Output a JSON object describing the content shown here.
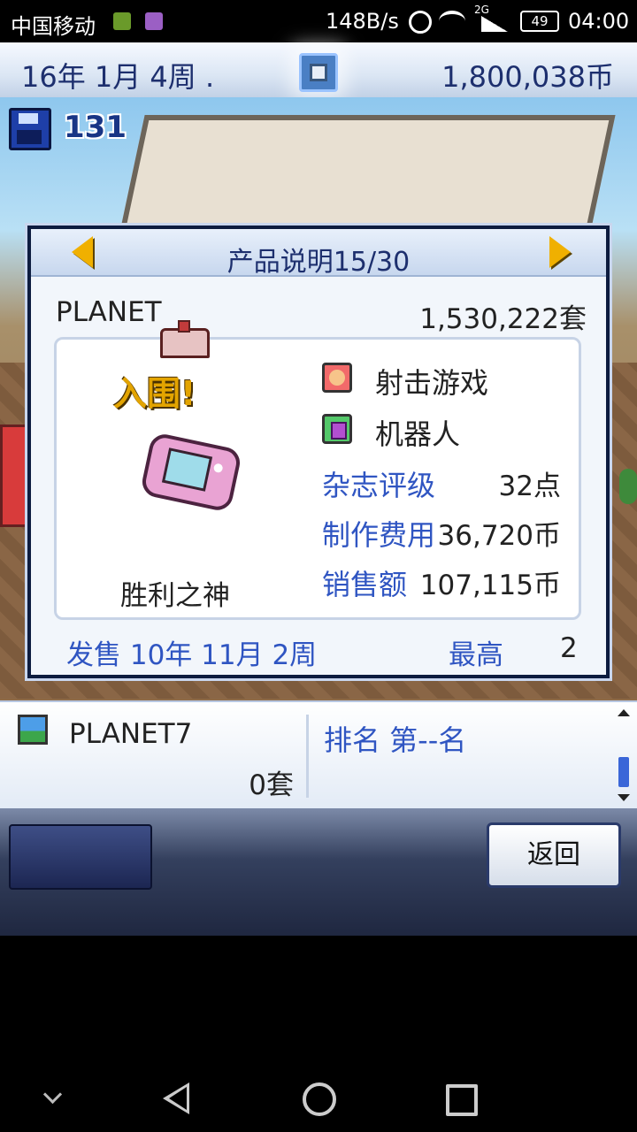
{
  "status_bar": {
    "carrier": "中国移动",
    "net_speed": "148B/s",
    "network_type": "2G",
    "battery": "49",
    "time": "04:00"
  },
  "hud": {
    "date": "16年 1月 4周 .",
    "money": "1,800,038币"
  },
  "scene": {
    "disk_count": "131"
  },
  "dialog": {
    "title": "产品说明15/30",
    "product_name": "PLANET",
    "product_sales": "1,530,222套",
    "nominee_text": "入围!",
    "console_name": "胜利之神",
    "genre": "射击游戏",
    "theme": "机器人",
    "stats": [
      {
        "label": "杂志评级",
        "value": "32点"
      },
      {
        "label": "制作费用",
        "value": "36,720币"
      },
      {
        "label": "销售额",
        "value": "107,115币"
      }
    ],
    "release": "发售 10年 11月 2周",
    "best_label": "最高",
    "best_value": "2"
  },
  "lower_panel": {
    "name": "PLANET7",
    "sales": "0套",
    "rank": "排名 第--名"
  },
  "footer": {
    "back_label": "返回"
  },
  "colors": {
    "accent_text": "#2f55c2",
    "hud_text": "#1d2f6e",
    "arrow_gold": "#f0b000"
  }
}
